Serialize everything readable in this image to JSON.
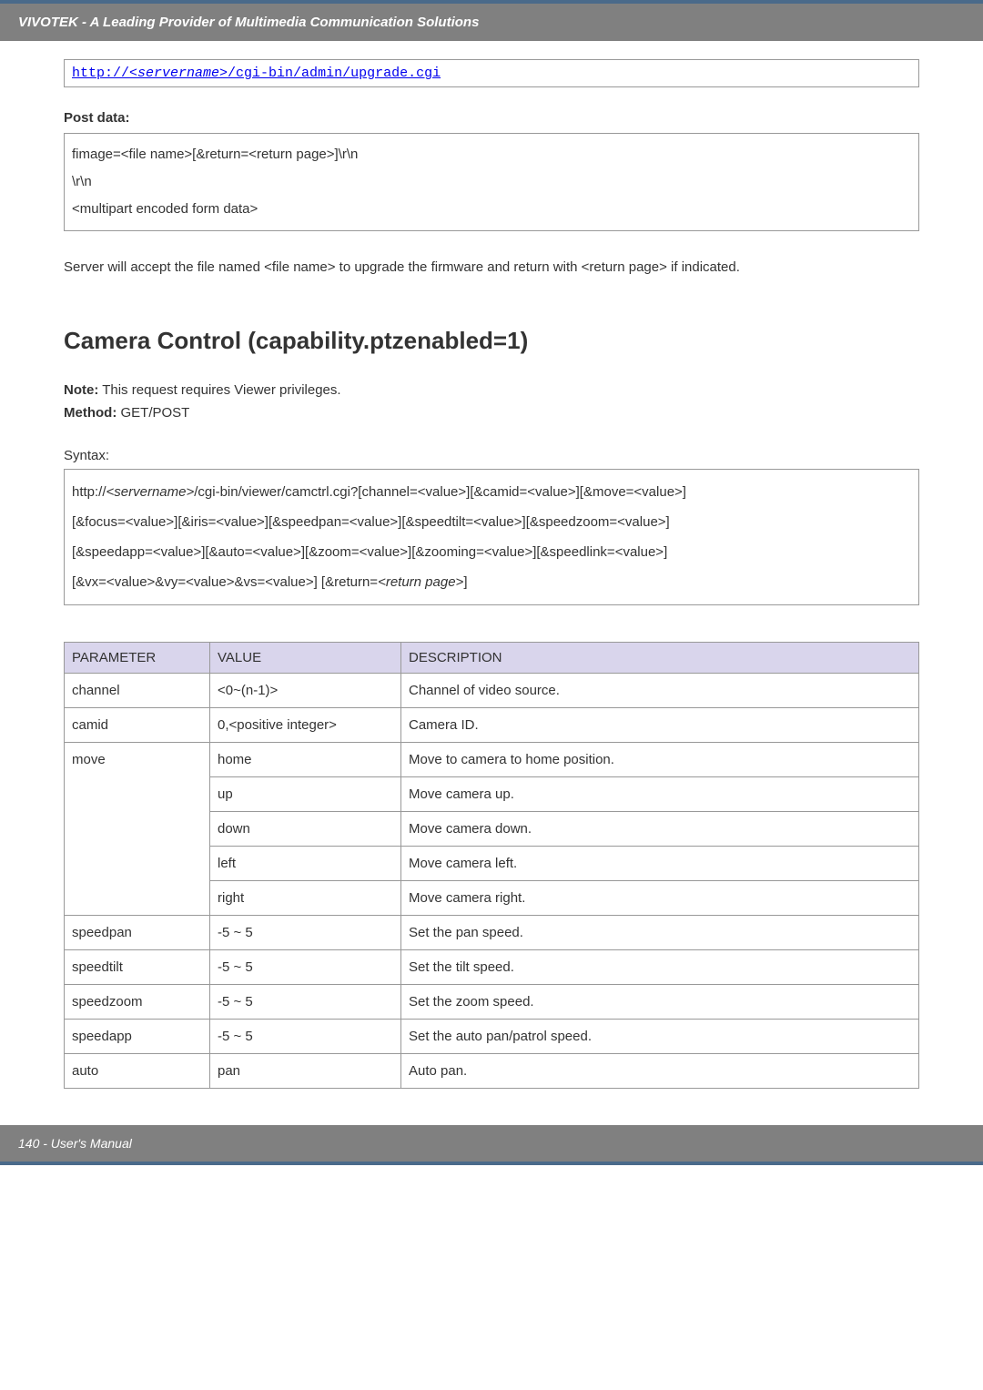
{
  "header": {
    "title": "VIVOTEK - A Leading Provider of Multimedia Communication Solutions"
  },
  "url_line": {
    "prefix": "http://",
    "servername": "<servername>",
    "suffix": "/cgi-bin/admin/upgrade.cgi"
  },
  "post_data": {
    "label": "Post data:",
    "line1": "fimage=<file name>[&return=<return page>]\\r\\n",
    "line2": "\\r\\n",
    "line3": "<multipart encoded form data>"
  },
  "desc": "Server will accept the file named <file name> to upgrade the firmware and return with <return page> if indicated.",
  "heading": "Camera Control (capability.ptzenabled=1)",
  "note": {
    "label": "Note:",
    "text": " This request requires Viewer privileges."
  },
  "method": {
    "label": "Method:",
    "text": " GET/POST"
  },
  "syntax": {
    "label": "Syntax:",
    "l1_prefix": "http://",
    "l1_server": "<servername>",
    "l1_rest": "/cgi-bin/viewer/camctrl.cgi?[channel=<value>][&camid=<value>][&move=<value>]",
    "l2": "[&focus=<value>][&iris=<value>][&speedpan=<value>][&speedtilt=<value>][&speedzoom=<value>]",
    "l3": "[&speedapp=<value>][&auto=<value>][&zoom=<value>][&zooming=<value>][&speedlink=<value>]",
    "l4_prefix": "[&vx=<value>&vy=<value>&vs=<value>] [&return=",
    "l4_return": "<return page>",
    "l4_suffix": "]"
  },
  "table": {
    "headers": {
      "p": "PARAMETER",
      "v": "VALUE",
      "d": "DESCRIPTION"
    },
    "rows": [
      {
        "p": "channel",
        "v": "<0~(n-1)>",
        "d": "Channel of video source."
      },
      {
        "p": "camid",
        "v": "0,<positive integer>",
        "d": "Camera ID."
      },
      {
        "p": "move",
        "v": "home",
        "d": "Move to camera to home position.",
        "rowspan": 5
      },
      {
        "p": "",
        "v": "up",
        "d": "Move camera up."
      },
      {
        "p": "",
        "v": "down",
        "d": "Move camera down."
      },
      {
        "p": "",
        "v": "left",
        "d": "Move camera left."
      },
      {
        "p": "",
        "v": "right",
        "d": "Move camera right."
      },
      {
        "p": "speedpan",
        "v": "-5 ~ 5",
        "d": "Set the pan speed."
      },
      {
        "p": "speedtilt",
        "v": "-5 ~ 5",
        "d": "Set the tilt speed."
      },
      {
        "p": "speedzoom",
        "v": "-5 ~ 5",
        "d": "Set the zoom speed."
      },
      {
        "p": "speedapp",
        "v": "-5 ~ 5",
        "d": "Set the auto pan/patrol speed."
      },
      {
        "p": "auto",
        "v": "pan",
        "d": "Auto pan."
      }
    ]
  },
  "footer": {
    "text": "140 - User's Manual"
  }
}
